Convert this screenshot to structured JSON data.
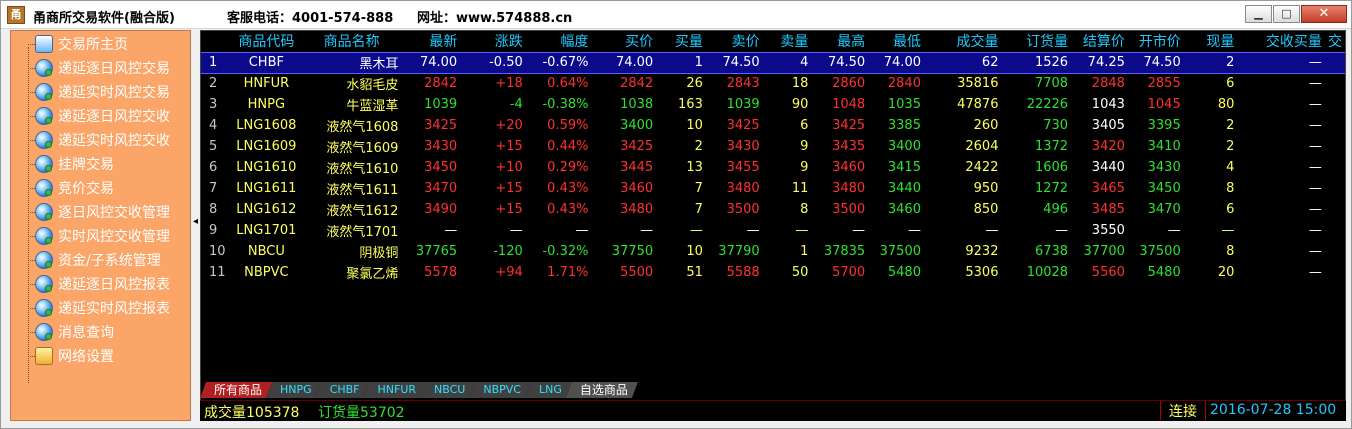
{
  "window": {
    "title": "甬商所交易软件(融合版)",
    "phone": "客服电话：4001-574-888",
    "website": "网址：www.574888.cn",
    "min_label": "▁",
    "max_label": "□",
    "close_label": "✕"
  },
  "sidebar": {
    "items": [
      {
        "label": "交易所主页",
        "icon": "home-icon"
      },
      {
        "label": "递延逐日风控交易",
        "icon": "globe-icon"
      },
      {
        "label": "递延实时风控交易",
        "icon": "globe-icon"
      },
      {
        "label": "递延逐日风控交收",
        "icon": "globe-icon"
      },
      {
        "label": "递延实时风控交收",
        "icon": "globe-icon"
      },
      {
        "label": "挂牌交易",
        "icon": "globe-icon"
      },
      {
        "label": "竞价交易",
        "icon": "globe-icon"
      },
      {
        "label": "逐日风控交收管理",
        "icon": "globe-icon"
      },
      {
        "label": "实时风控交收管理",
        "icon": "globe-icon"
      },
      {
        "label": "资金/子系统管理",
        "icon": "globe-icon"
      },
      {
        "label": "递延逐日风控报表",
        "icon": "globe-icon"
      },
      {
        "label": "递延实时风控报表",
        "icon": "globe-icon"
      },
      {
        "label": "消息查询",
        "icon": "globe-icon"
      },
      {
        "label": "网络设置",
        "icon": "network-icon"
      }
    ]
  },
  "splitter": {
    "arrow": "◂"
  },
  "table": {
    "headers": [
      "",
      "商品代码",
      "商品名称",
      "最新",
      "涨跌",
      "幅度",
      "买价",
      "买量",
      "卖价",
      "卖量",
      "最高",
      "最低",
      "成交量",
      "订货量",
      "结算价",
      "开市价",
      "现量",
      "交收买量",
      "交"
    ],
    "rows": [
      {
        "idx": "1",
        "code": "CHBF",
        "name": "黑木耳",
        "last": "74.00",
        "chg": "-0.50",
        "pct": "-0.67%",
        "bid": "74.00",
        "bidv": "1",
        "ask": "74.50",
        "askv": "4",
        "high": "74.50",
        "low": "74.00",
        "vol": "62",
        "oi": "1526",
        "settle": "74.25",
        "open": "74.50",
        "cur": "2",
        "dlv": "—",
        "dir": "dn",
        "sel": true,
        "cls": {
          "last": "w",
          "chg": "w",
          "pct": "w",
          "bid": "w",
          "ask": "w",
          "high": "w",
          "low": "w",
          "settle": "w",
          "open": "w"
        }
      },
      {
        "idx": "2",
        "code": "HNFUR",
        "name": "水貂毛皮",
        "last": "2842",
        "chg": "+18",
        "pct": "0.64%",
        "bid": "2842",
        "bidv": "26",
        "ask": "2843",
        "askv": "18",
        "high": "2860",
        "low": "2840",
        "vol": "35816",
        "oi": "7708",
        "settle": "2848",
        "open": "2855",
        "cur": "6",
        "dlv": "—",
        "cls": {
          "last": "up",
          "chg": "up",
          "pct": "up",
          "bid": "up",
          "ask": "up",
          "high": "up",
          "low": "up",
          "settle": "up",
          "open": "up"
        }
      },
      {
        "idx": "3",
        "code": "HNPG",
        "name": "牛蓝湿革",
        "last": "1039",
        "chg": "-4",
        "pct": "-0.38%",
        "bid": "1038",
        "bidv": "163",
        "ask": "1039",
        "askv": "90",
        "high": "1048",
        "low": "1035",
        "vol": "47876",
        "oi": "22226",
        "settle": "1043",
        "open": "1045",
        "cur": "80",
        "dlv": "—",
        "cls": {
          "last": "dn",
          "chg": "dn",
          "pct": "dn",
          "bid": "dn",
          "ask": "dn",
          "high": "up",
          "low": "dn",
          "settle": "w",
          "open": "up"
        }
      },
      {
        "idx": "4",
        "code": "LNG1608",
        "name": "液然气1608",
        "last": "3425",
        "chg": "+20",
        "pct": "0.59%",
        "bid": "3400",
        "bidv": "10",
        "ask": "3425",
        "askv": "6",
        "high": "3425",
        "low": "3385",
        "vol": "260",
        "oi": "730",
        "settle": "3405",
        "open": "3395",
        "cur": "2",
        "dlv": "—",
        "cls": {
          "last": "up",
          "chg": "up",
          "pct": "up",
          "bid": "dn",
          "ask": "up",
          "high": "up",
          "low": "dn",
          "settle": "w",
          "open": "dn"
        }
      },
      {
        "idx": "5",
        "code": "LNG1609",
        "name": "液然气1609",
        "last": "3430",
        "chg": "+15",
        "pct": "0.44%",
        "bid": "3425",
        "bidv": "2",
        "ask": "3430",
        "askv": "9",
        "high": "3435",
        "low": "3400",
        "vol": "2604",
        "oi": "1372",
        "settle": "3420",
        "open": "3410",
        "cur": "2",
        "dlv": "—",
        "cls": {
          "last": "up",
          "chg": "up",
          "pct": "up",
          "bid": "up",
          "ask": "up",
          "high": "up",
          "low": "dn",
          "settle": "up",
          "open": "dn"
        }
      },
      {
        "idx": "6",
        "code": "LNG1610",
        "name": "液然气1610",
        "last": "3450",
        "chg": "+10",
        "pct": "0.29%",
        "bid": "3445",
        "bidv": "13",
        "ask": "3455",
        "askv": "9",
        "high": "3460",
        "low": "3415",
        "vol": "2422",
        "oi": "1606",
        "settle": "3440",
        "open": "3430",
        "cur": "4",
        "dlv": "—",
        "cls": {
          "last": "up",
          "chg": "up",
          "pct": "up",
          "bid": "up",
          "ask": "up",
          "high": "up",
          "low": "dn",
          "settle": "w",
          "open": "dn"
        }
      },
      {
        "idx": "7",
        "code": "LNG1611",
        "name": "液然气1611",
        "last": "3470",
        "chg": "+15",
        "pct": "0.43%",
        "bid": "3460",
        "bidv": "7",
        "ask": "3480",
        "askv": "11",
        "high": "3480",
        "low": "3440",
        "vol": "950",
        "oi": "1272",
        "settle": "3465",
        "open": "3450",
        "cur": "8",
        "dlv": "—",
        "cls": {
          "last": "up",
          "chg": "up",
          "pct": "up",
          "bid": "up",
          "ask": "up",
          "high": "up",
          "low": "dn",
          "settle": "up",
          "open": "dn"
        }
      },
      {
        "idx": "8",
        "code": "LNG1612",
        "name": "液然气1612",
        "last": "3490",
        "chg": "+15",
        "pct": "0.43%",
        "bid": "3480",
        "bidv": "7",
        "ask": "3500",
        "askv": "8",
        "high": "3500",
        "low": "3460",
        "vol": "850",
        "oi": "496",
        "settle": "3485",
        "open": "3470",
        "cur": "6",
        "dlv": "—",
        "cls": {
          "last": "up",
          "chg": "up",
          "pct": "up",
          "bid": "up",
          "ask": "up",
          "high": "up",
          "low": "dn",
          "settle": "up",
          "open": "dn"
        }
      },
      {
        "idx": "9",
        "code": "LNG1701",
        "name": "液然气1701",
        "last": "—",
        "chg": "—",
        "pct": "—",
        "bid": "—",
        "bidv": "—",
        "ask": "—",
        "askv": "—",
        "high": "—",
        "low": "—",
        "vol": "—",
        "oi": "—",
        "settle": "3550",
        "open": "—",
        "cur": "—",
        "dlv": "—",
        "cls": {
          "last": "w",
          "chg": "w",
          "pct": "w",
          "bid": "w",
          "ask": "w",
          "high": "w",
          "low": "w",
          "settle": "w",
          "open": "w"
        }
      },
      {
        "idx": "10",
        "code": "NBCU",
        "name": "阴极铜",
        "last": "37765",
        "chg": "-120",
        "pct": "-0.32%",
        "bid": "37750",
        "bidv": "10",
        "ask": "37790",
        "askv": "1",
        "high": "37835",
        "low": "37500",
        "vol": "9232",
        "oi": "6738",
        "settle": "37700",
        "open": "37500",
        "cur": "8",
        "dlv": "—",
        "cls": {
          "last": "dn",
          "chg": "dn",
          "pct": "dn",
          "bid": "dn",
          "ask": "dn",
          "high": "dn",
          "low": "dn",
          "settle": "dn",
          "open": "dn"
        }
      },
      {
        "idx": "11",
        "code": "NBPVC",
        "name": "聚氯乙烯",
        "last": "5578",
        "chg": "+94",
        "pct": "1.71%",
        "bid": "5500",
        "bidv": "51",
        "ask": "5588",
        "askv": "50",
        "high": "5700",
        "low": "5480",
        "vol": "5306",
        "oi": "10028",
        "settle": "5560",
        "open": "5480",
        "cur": "20",
        "dlv": "—",
        "cls": {
          "last": "up",
          "chg": "up",
          "pct": "up",
          "bid": "up",
          "ask": "up",
          "high": "up",
          "low": "dn",
          "settle": "up",
          "open": "dn"
        }
      }
    ]
  },
  "tabs": [
    "所有商品",
    "HNPG",
    "CHBF",
    "HNFUR",
    "NBCU",
    "NBPVC",
    "LNG",
    "自选商品"
  ],
  "status": {
    "volume": "成交量105378",
    "open_interest": "订货量53702",
    "connection": "连接",
    "datetime": "2016-07-28 15:00"
  },
  "colors": {
    "up": "#ff3030",
    "down": "#30e030",
    "header": "#1ec8ff",
    "sidebar": "#fba569",
    "selected_row": "#0a0a8a"
  }
}
